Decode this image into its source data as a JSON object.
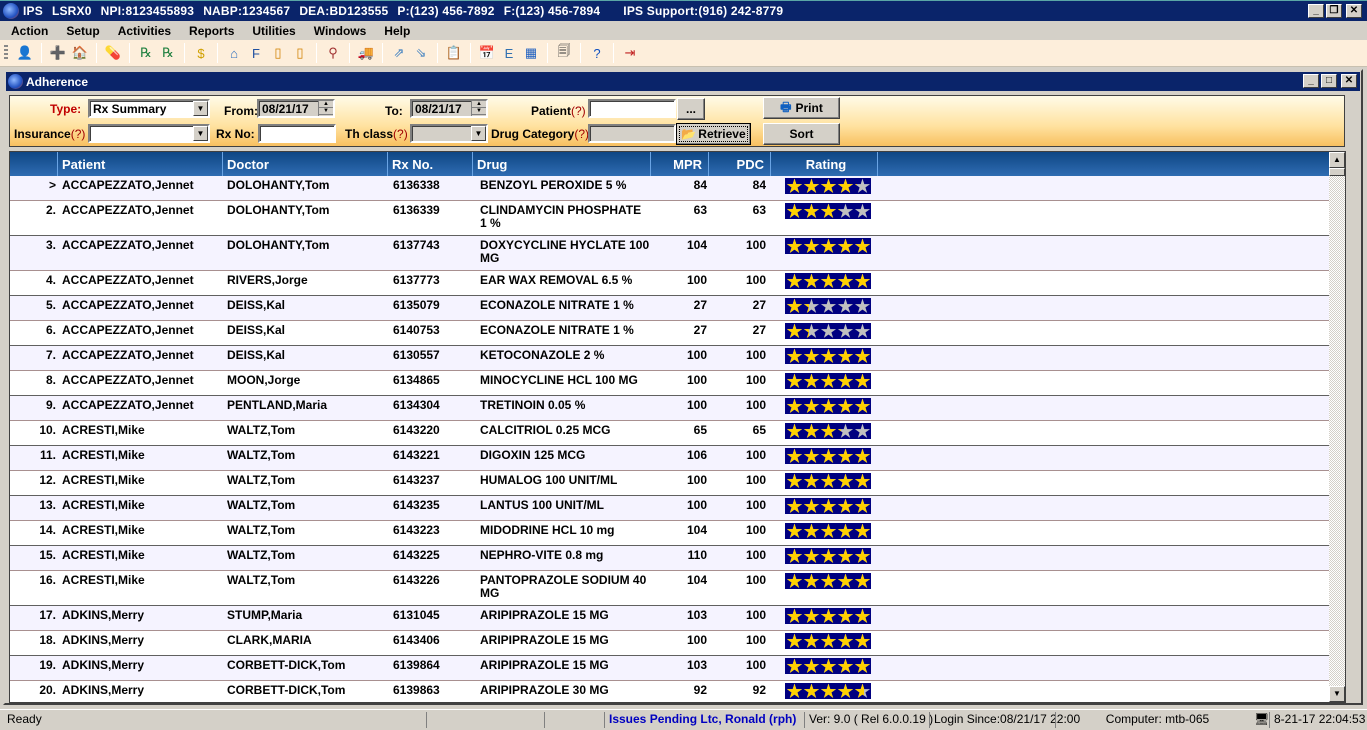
{
  "app": {
    "title_segments": [
      "IPS",
      "LSRX0",
      "NPI:8123455893",
      "NABP:1234567",
      "DEA:BD123555",
      "P:(123) 456-7892",
      "F:(123) 456-7894"
    ],
    "support": "IPS Support:(916) 242-8779",
    "window_controls": {
      "minimize": "_",
      "restore": "❐",
      "close": "✕"
    }
  },
  "menu": [
    "Action",
    "Setup",
    "Activities",
    "Reports",
    "Utilities",
    "Windows",
    "Help"
  ],
  "toolbar": {
    "groups": [
      [
        {
          "icon": "pharmacist-icon",
          "glyph": "👤"
        }
      ],
      [
        {
          "icon": "add-patient-icon",
          "glyph": "➕"
        },
        {
          "icon": "facility-icon",
          "glyph": "🏠"
        }
      ],
      [
        {
          "icon": "medication-icon",
          "glyph": "💊"
        }
      ],
      [
        {
          "icon": "rx-list-icon",
          "glyph": "℞"
        },
        {
          "icon": "rx-verify-icon",
          "glyph": "℞"
        }
      ],
      [
        {
          "icon": "billing-icon",
          "glyph": "$"
        }
      ],
      [
        {
          "icon": "search-facility-icon",
          "glyph": "⌂"
        },
        {
          "icon": "fill-icon",
          "glyph": "F"
        },
        {
          "icon": "refill-icon",
          "glyph": "▯"
        },
        {
          "icon": "refill-check-icon",
          "glyph": "▯"
        }
      ],
      [
        {
          "icon": "workflow-icon",
          "glyph": "⚲"
        }
      ],
      [
        {
          "icon": "delivery-truck-icon",
          "glyph": "🚚"
        }
      ],
      [
        {
          "icon": "transfer-out-icon",
          "glyph": "⇗"
        },
        {
          "icon": "transfer-in-icon",
          "glyph": "⇘"
        }
      ],
      [
        {
          "icon": "reports-icon",
          "glyph": "📋"
        }
      ],
      [
        {
          "icon": "schedule-icon",
          "glyph": "📅"
        },
        {
          "icon": "med-info-icon",
          "glyph": "E"
        },
        {
          "icon": "calendar-grid-icon",
          "glyph": "▦"
        }
      ],
      [
        {
          "icon": "documents-icon",
          "glyph": "🗐"
        }
      ],
      [
        {
          "icon": "help-icon",
          "glyph": "?"
        }
      ],
      [
        {
          "icon": "exit-icon",
          "glyph": "⇥"
        }
      ]
    ]
  },
  "window": {
    "title": "Adherence",
    "controls": {
      "minimize": "_",
      "maximize": "□",
      "close": "✕"
    }
  },
  "filters": {
    "type_label": "Type:",
    "type_value": "Rx Summary",
    "from_label": "From:",
    "from_value": "08/21/17",
    "to_label": "To:",
    "to_value": "08/21/17",
    "patient_label": "Patient",
    "patient_value": "",
    "patient_browse": "...",
    "insurance_label": "Insurance",
    "insurance_value": "",
    "rxno_label": "Rx No:",
    "rxno_value": "",
    "thclass_label": "Th class",
    "thclass_value": "",
    "drugcat_label": "Drug Category",
    "drugcat_value": "",
    "help_mark": "(?)",
    "print_label": "Print",
    "retrieve_label": "Retrieve",
    "sort_label": "Sort"
  },
  "grid": {
    "columns": [
      "Patient",
      "Doctor",
      "Rx No.",
      "Drug",
      "MPR",
      "PDC",
      "Rating"
    ],
    "rating_max": 5,
    "rows": [
      {
        "num": ">",
        "patient": "ACCAPEZZATO,Jennet",
        "doctor": "DOLOHANTY,Tom",
        "rx": "6136338",
        "drug": "BENZOYL PEROXIDE 5 %",
        "mpr": "84",
        "pdc": "84",
        "rating": 4.2,
        "tall": false
      },
      {
        "num": "2.",
        "patient": "ACCAPEZZATO,Jennet",
        "doctor": "DOLOHANTY,Tom",
        "rx": "6136339",
        "drug": "CLINDAMYCIN PHOSPHATE 1 %",
        "mpr": "63",
        "pdc": "63",
        "rating": 3.15,
        "tall": true
      },
      {
        "num": "3.",
        "patient": "ACCAPEZZATO,Jennet",
        "doctor": "DOLOHANTY,Tom",
        "rx": "6137743",
        "drug": "DOXYCYCLINE HYCLATE 100 MG",
        "mpr": "104",
        "pdc": "100",
        "rating": 5,
        "tall": true
      },
      {
        "num": "4.",
        "patient": "ACCAPEZZATO,Jennet",
        "doctor": "RIVERS,Jorge",
        "rx": "6137773",
        "drug": "EAR WAX REMOVAL 6.5 %",
        "mpr": "100",
        "pdc": "100",
        "rating": 5,
        "tall": false
      },
      {
        "num": "5.",
        "patient": "ACCAPEZZATO,Jennet",
        "doctor": "DEISS,Kal",
        "rx": "6135079",
        "drug": "ECONAZOLE NITRATE 1 %",
        "mpr": "27",
        "pdc": "27",
        "rating": 1.35,
        "tall": false
      },
      {
        "num": "6.",
        "patient": "ACCAPEZZATO,Jennet",
        "doctor": "DEISS,Kal",
        "rx": "6140753",
        "drug": "ECONAZOLE NITRATE 1 %",
        "mpr": "27",
        "pdc": "27",
        "rating": 1.35,
        "tall": false
      },
      {
        "num": "7.",
        "patient": "ACCAPEZZATO,Jennet",
        "doctor": "DEISS,Kal",
        "rx": "6130557",
        "drug": "KETOCONAZOLE 2 %",
        "mpr": "100",
        "pdc": "100",
        "rating": 5,
        "tall": false
      },
      {
        "num": "8.",
        "patient": "ACCAPEZZATO,Jennet",
        "doctor": "MOON,Jorge",
        "rx": "6134865",
        "drug": "MINOCYCLINE HCL 100 MG",
        "mpr": "100",
        "pdc": "100",
        "rating": 5,
        "tall": false
      },
      {
        "num": "9.",
        "patient": "ACCAPEZZATO,Jennet",
        "doctor": "PENTLAND,Maria",
        "rx": "6134304",
        "drug": "TRETINOIN 0.05 %",
        "mpr": "100",
        "pdc": "100",
        "rating": 5,
        "tall": false
      },
      {
        "num": "10.",
        "patient": "ACRESTI,Mike",
        "doctor": "WALTZ,Tom",
        "rx": "6143220",
        "drug": "CALCITRIOL 0.25 MCG",
        "mpr": "65",
        "pdc": "65",
        "rating": 3.25,
        "tall": false
      },
      {
        "num": "11.",
        "patient": "ACRESTI,Mike",
        "doctor": "WALTZ,Tom",
        "rx": "6143221",
        "drug": "DIGOXIN 125 MCG",
        "mpr": "106",
        "pdc": "100",
        "rating": 5,
        "tall": false
      },
      {
        "num": "12.",
        "patient": "ACRESTI,Mike",
        "doctor": "WALTZ,Tom",
        "rx": "6143237",
        "drug": "HUMALOG 100 UNIT/ML",
        "mpr": "100",
        "pdc": "100",
        "rating": 5,
        "tall": false
      },
      {
        "num": "13.",
        "patient": "ACRESTI,Mike",
        "doctor": "WALTZ,Tom",
        "rx": "6143235",
        "drug": "LANTUS 100 UNIT/ML",
        "mpr": "100",
        "pdc": "100",
        "rating": 5,
        "tall": false
      },
      {
        "num": "14.",
        "patient": "ACRESTI,Mike",
        "doctor": "WALTZ,Tom",
        "rx": "6143223",
        "drug": "MIDODRINE HCL 10 mg",
        "mpr": "104",
        "pdc": "100",
        "rating": 5,
        "tall": false
      },
      {
        "num": "15.",
        "patient": "ACRESTI,Mike",
        "doctor": "WALTZ,Tom",
        "rx": "6143225",
        "drug": "NEPHRO-VITE 0.8 mg",
        "mpr": "110",
        "pdc": "100",
        "rating": 5,
        "tall": false
      },
      {
        "num": "16.",
        "patient": "ACRESTI,Mike",
        "doctor": "WALTZ,Tom",
        "rx": "6143226",
        "drug": "PANTOPRAZOLE SODIUM 40 MG",
        "mpr": "104",
        "pdc": "100",
        "rating": 5,
        "tall": true
      },
      {
        "num": "17.",
        "patient": "ADKINS,Merry",
        "doctor": "STUMP,Maria",
        "rx": "6131045",
        "drug": "ARIPIPRAZOLE 15 MG",
        "mpr": "103",
        "pdc": "100",
        "rating": 5,
        "tall": false
      },
      {
        "num": "18.",
        "patient": "ADKINS,Merry",
        "doctor": "CLARK,MARIA",
        "rx": "6143406",
        "drug": "ARIPIPRAZOLE 15 MG",
        "mpr": "100",
        "pdc": "100",
        "rating": 5,
        "tall": false
      },
      {
        "num": "19.",
        "patient": "ADKINS,Merry",
        "doctor": "CORBETT-DICK,Tom",
        "rx": "6139864",
        "drug": "ARIPIPRAZOLE 15 MG",
        "mpr": "103",
        "pdc": "100",
        "rating": 5,
        "tall": false
      },
      {
        "num": "20.",
        "patient": "ADKINS,Merry",
        "doctor": "CORBETT-DICK,Tom",
        "rx": "6139863",
        "drug": "ARIPIPRAZOLE 30 MG",
        "mpr": "92",
        "pdc": "92",
        "rating": 4.6,
        "tall": false
      }
    ],
    "scroll_up": "▲",
    "scroll_down": "▼"
  },
  "status": {
    "ready": "Ready",
    "pending": "Issues Pending Ltc, Ronald (rph)",
    "version": "Ver: 9.0 ( Rel 6.0.0.19 )",
    "login": "Login Since:08/21/17 22:00",
    "computer": "Computer: mtb-065",
    "datetime": "8-21-17 22:04:53"
  }
}
